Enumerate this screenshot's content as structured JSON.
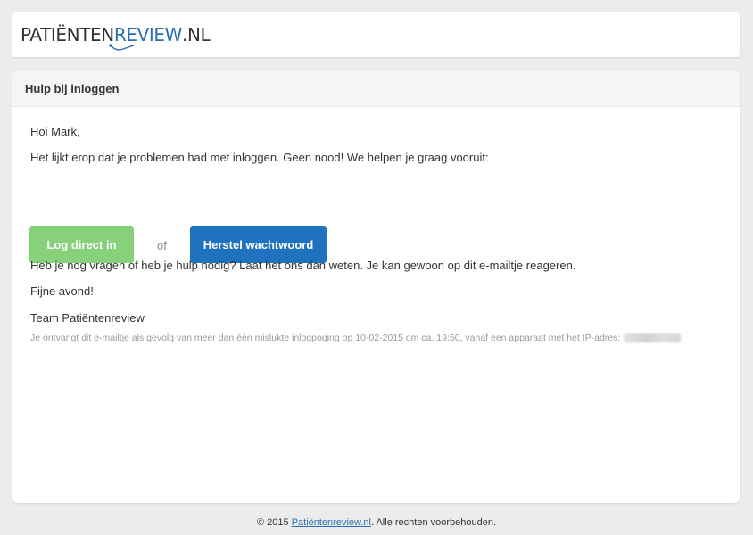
{
  "brand": {
    "logo_part1": "PATIËNTEN",
    "logo_part2": "REVIEW",
    "logo_part3": ".NL"
  },
  "card": {
    "title": "Hulp bij inloggen"
  },
  "email": {
    "greeting": "Hoi Mark,",
    "intro": "Het lijkt erop dat je problemen had met inloggen. Geen nood! We helpen je graag vooruit:",
    "login_button": "Log direct in",
    "or_text": "of",
    "reset_button": "Herstel wachtwoord",
    "questions": "Heb je nog vragen of heb je hulp nodig? Laat het ons dan weten. Je kan gewoon op dit e-mailtje reageren.",
    "closing": "Fijne avond!",
    "signature": "Team Patiëntenreview",
    "notice": "Je ontvangt dit e-mailtje als gevolg van meer dan één mislukte inlogpoging op 10-02-2015 om ca. 19:50, vanaf een apparaat met het IP-adres:"
  },
  "footer": {
    "prefix": "© 2015 ",
    "link": "Patiëntenreview.nl",
    "suffix": ". Alle rechten voorbehouden."
  },
  "colors": {
    "background": "#ececec",
    "brand_blue": "#1f72be",
    "login_green": "#86d17a"
  }
}
